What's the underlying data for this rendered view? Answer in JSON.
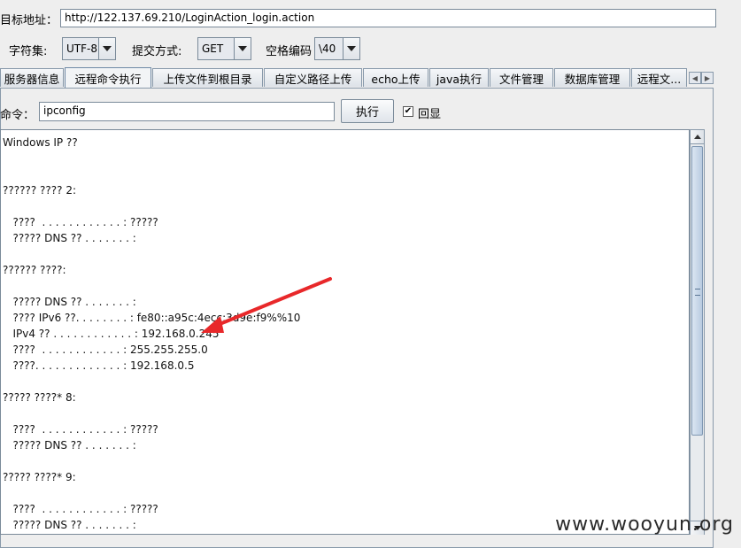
{
  "header": {
    "target_label": "目标地址：",
    "target_url": "http://122.137.69.210/LoginAction_login.action",
    "charset_label": "字符集:",
    "charset_value": "UTF-8",
    "method_label": "提交方式:",
    "method_value": "GET",
    "space_label": "空格编码",
    "space_value": "\\40"
  },
  "tabs": [
    {
      "label": "服务器信息",
      "active": false
    },
    {
      "label": "远程命令执行",
      "active": true
    },
    {
      "label": "上传文件到根目录",
      "active": false
    },
    {
      "label": "自定义路径上传",
      "active": false
    },
    {
      "label": "echo上传",
      "active": false
    },
    {
      "label": "java执行",
      "active": false
    },
    {
      "label": "文件管理",
      "active": false
    },
    {
      "label": "数据库管理",
      "active": false
    },
    {
      "label": "远程文...",
      "active": false
    }
  ],
  "command": {
    "label": "命令：",
    "value": "ipconfig",
    "execute_label": "执行",
    "echo_label": "回显",
    "echo_checked": true
  },
  "output_lines": [
    "Windows IP ??",
    "",
    "",
    "?????? ???? 2:",
    "",
    "   ????  . . . . . . . . . . . . : ?????",
    "   ????? DNS ?? . . . . . . . :",
    "",
    "?????? ????:",
    "",
    "   ????? DNS ?? . . . . . . . :",
    "   ???? IPv6 ??. . . . . . . . : fe80::a95c:4ecc:3d9e:f9%%10",
    "   IPv4 ?? . . . . . . . . . . . . : 192.168.0.245",
    "   ????  . . . . . . . . . . . . : 255.255.255.0",
    "   ????. . . . . . . . . . . . . : 192.168.0.5",
    "",
    "????? ????* 8:",
    "",
    "   ????  . . . . . . . . . . . . : ?????",
    "   ????? DNS ?? . . . . . . . :",
    "",
    "????? ????* 9:",
    "",
    "   ????  . . . . . . . . . . . . : ?????",
    "   ????? DNS ?? . . . . . . . :"
  ],
  "watermark": "www.wooyun.org",
  "colors": {
    "arrow": "#e8282a"
  }
}
